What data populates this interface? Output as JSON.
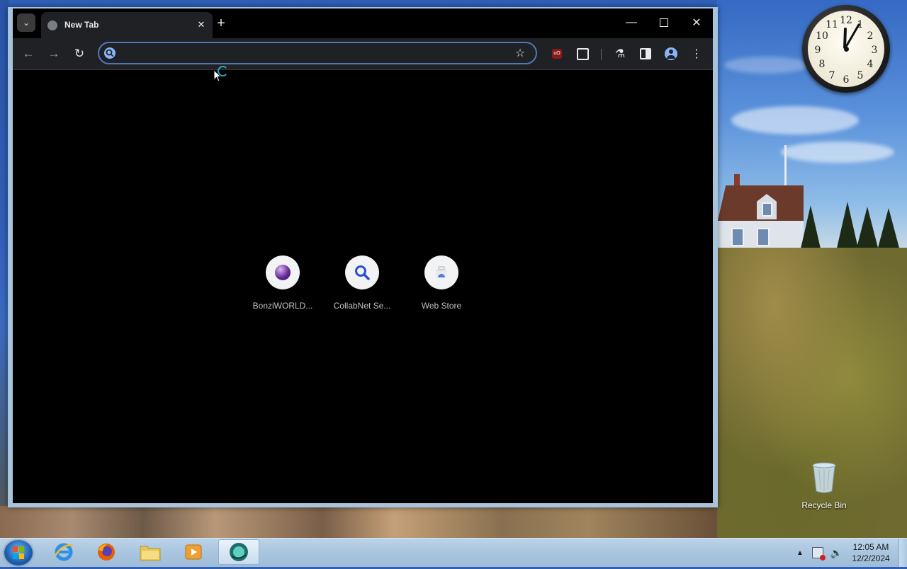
{
  "browser": {
    "tab": {
      "title": "New Tab"
    },
    "omnibox": {
      "value": "",
      "placeholder": ""
    },
    "shortcuts": [
      {
        "label": "BonziWORLD...",
        "icon": "purple-orb-icon"
      },
      {
        "label": "CollabNet Se...",
        "icon": "magnifier-icon"
      },
      {
        "label": "Web Store",
        "icon": "web-store-icon"
      }
    ],
    "extensions": [
      "ublock-origin-icon",
      "extensions-puzzle-icon",
      "labs-flask-icon",
      "side-panel-icon",
      "profile-icon",
      "menu-icon"
    ]
  },
  "desktop": {
    "recycle_bin_label": "Recycle Bin",
    "clock_gadget": {
      "hour": 12,
      "minute": 5
    }
  },
  "taskbar": {
    "apps": [
      "internet-explorer-icon",
      "firefox-icon",
      "file-explorer-icon",
      "media-player-icon",
      "browser-app-icon"
    ],
    "time": "12:05 AM",
    "date": "12/2/2024"
  }
}
